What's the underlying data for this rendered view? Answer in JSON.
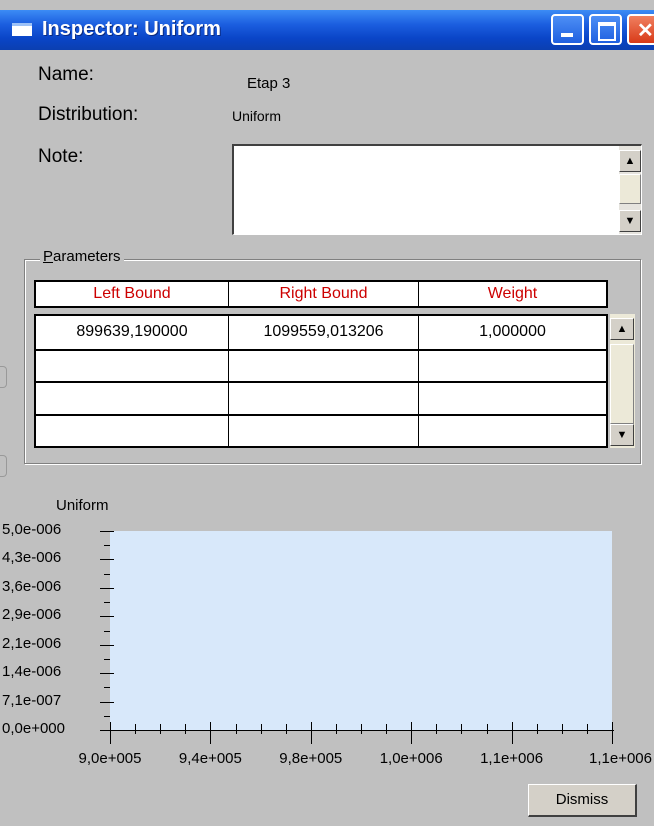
{
  "window": {
    "title": "Inspector: Uniform",
    "controls": [
      "minimize-icon",
      "maximize-icon",
      "close-icon"
    ]
  },
  "fields": {
    "name_label": "Name:",
    "name_value": "Etap 3",
    "distribution_label": "Distribution:",
    "distribution_value": "Uniform",
    "note_label": "Note:",
    "note_value": ""
  },
  "parameters": {
    "group_label_mnemonic": "P",
    "group_label_rest": "arameters",
    "columns": [
      "Left Bound",
      "Right Bound",
      "Weight"
    ],
    "rows": [
      [
        "899639,190000",
        "1099559,013206",
        "1,000000"
      ],
      [
        "",
        "",
        ""
      ],
      [
        "",
        "",
        ""
      ],
      [
        "",
        "",
        ""
      ]
    ]
  },
  "chart_data": {
    "type": "area",
    "title": "Uniform",
    "xlabel": "",
    "ylabel": "",
    "y_tick_labels": [
      "5,0e-006",
      "4,3e-006",
      "3,6e-006",
      "2,9e-006",
      "2,1e-006",
      "1,4e-006",
      "7,1e-007",
      "0,0e+000"
    ],
    "x_tick_labels": [
      "9,0e+005",
      "9,4e+005",
      "9,8e+005",
      "1,0e+006",
      "1,1e+006",
      "1,1e+006"
    ],
    "xlim": [
      899639.19,
      1099559.013206
    ],
    "ylim": [
      0,
      5e-06
    ],
    "series": [
      {
        "x": [
          899639.19,
          1099559.013206
        ],
        "values": [
          5e-06,
          5e-06
        ]
      }
    ],
    "fill_color": "#d8e8fa",
    "grid": false
  },
  "buttons": {
    "dismiss": "Dismiss"
  },
  "colors": {
    "title_bar": "#0a45c8",
    "header_text": "#cc0000",
    "window_bg": "#c0c0c0"
  }
}
